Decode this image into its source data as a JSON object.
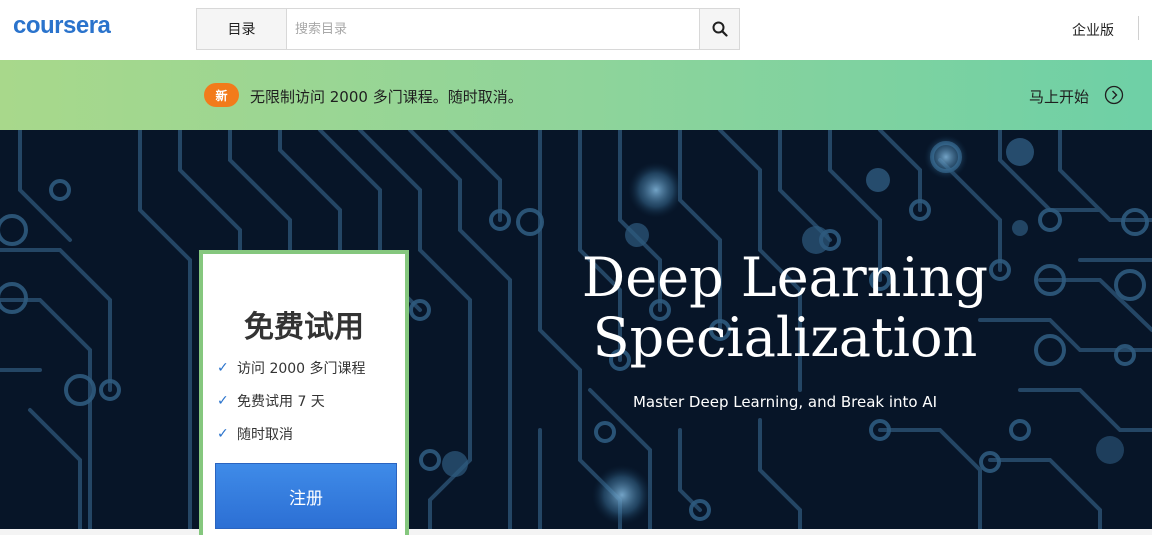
{
  "header": {
    "logo": "coursera",
    "catalog_label": "目录",
    "search_placeholder": "搜索目录",
    "enterprise_label": "企业版"
  },
  "promo": {
    "badge": "新",
    "text": "无限制访问 2000 多门课程。随时取消。",
    "cta": "马上开始",
    "colors": {
      "badge": "#f27b1b",
      "gradient_start": "#a8d88b",
      "gradient_end": "#6ed0a6"
    }
  },
  "hero": {
    "title_line1": "Deep Learning",
    "title_line2": "Specialization",
    "subtitle": "Master Deep Learning, and Break into AI",
    "background_color": "#071528"
  },
  "trial": {
    "title": "免费试用",
    "items": [
      "访问 2000 多门课程",
      "免费试用 7 天",
      "随时取消"
    ],
    "signup_label": "注册",
    "border_color": "#85c77e",
    "button_color": "#3a84e3"
  },
  "icons": {
    "search": "search-icon",
    "cta_arrow": "chevron-right-circle-icon",
    "check": "check-icon"
  }
}
